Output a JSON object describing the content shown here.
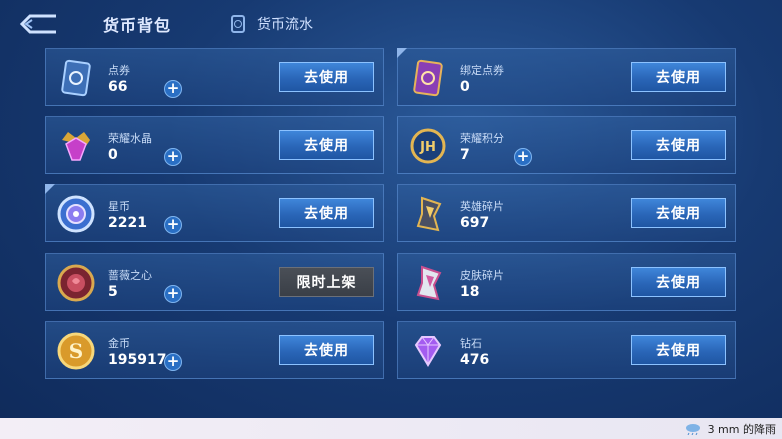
{
  "header": {
    "title": "货币背包",
    "flow_label": "货币流水"
  },
  "cards": [
    {
      "name": "点券",
      "amount": "66",
      "button": "去使用",
      "plus": true,
      "icon": "ticket-icon"
    },
    {
      "name": "绑定点券",
      "amount": "0",
      "button": "去使用",
      "plus": false,
      "icon": "bound-ticket-icon"
    },
    {
      "name": "荣耀水晶",
      "amount": "0",
      "button": "去使用",
      "plus": true,
      "icon": "glory-crystal-icon"
    },
    {
      "name": "荣耀积分",
      "amount": "7",
      "button": "去使用",
      "plus": true,
      "icon": "glory-points-icon"
    },
    {
      "name": "星币",
      "amount": "2221",
      "button": "去使用",
      "plus": true,
      "icon": "star-coin-icon"
    },
    {
      "name": "英雄碎片",
      "amount": "697",
      "button": "去使用",
      "plus": false,
      "icon": "hero-fragment-icon"
    },
    {
      "name": "蔷薇之心",
      "amount": "5",
      "button": "限时上架",
      "plus": true,
      "icon": "rose-heart-icon"
    },
    {
      "name": "皮肤碎片",
      "amount": "18",
      "button": "去使用",
      "plus": false,
      "icon": "skin-fragment-icon"
    },
    {
      "name": "金币",
      "amount": "195917",
      "button": "去使用",
      "plus": true,
      "icon": "gold-coin-icon"
    },
    {
      "name": "钻石",
      "amount": "476",
      "button": "去使用",
      "plus": false,
      "icon": "diamond-icon"
    }
  ],
  "status": {
    "weather": "3 mm 的降雨"
  },
  "colors": {
    "button": "#2a66b8",
    "button_disabled": "#3a3f47",
    "background": "#173a72"
  }
}
